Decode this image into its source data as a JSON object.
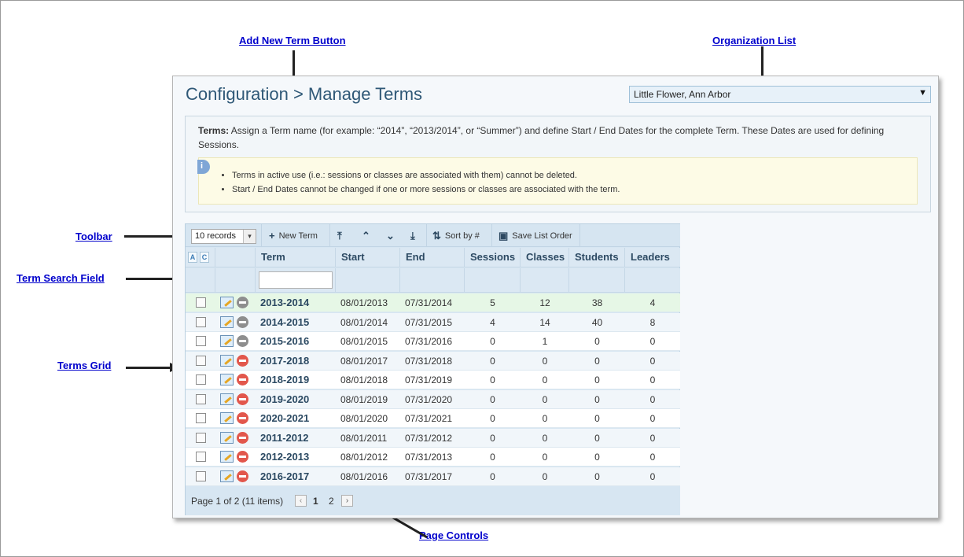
{
  "annotations": {
    "add_new_term": "Add New Term Button",
    "organization_list": "Organization List",
    "toolbar": "Toolbar",
    "term_search_field": "Term Search Field",
    "terms_grid": "Terms Grid",
    "page_controls": "Page Controls"
  },
  "header": {
    "title": "Configuration > Manage Terms",
    "organization": "Little Flower, Ann Arbor"
  },
  "info": {
    "label": "Terms:",
    "text": " Assign a Term name (for example: “2014”, “2013/2014”, or “Summer”) and define Start / End Dates for the complete Term. These Dates are used for defining Sessions.",
    "icon": "i",
    "notes": [
      "Terms in active use (i.e.: sessions or classes are associated with them) cannot be deleted.",
      "Start / End Dates cannot be changed if one or more sessions or classes are associated with the term."
    ]
  },
  "toolbar": {
    "records": "10 records",
    "new_term": "New Term",
    "sort_by": "Sort by #",
    "save_order": "Save List Order"
  },
  "grid": {
    "select_all": "A",
    "clear_all": "C",
    "columns": [
      "Term",
      "Start",
      "End",
      "Sessions",
      "Classes",
      "Students",
      "Leaders"
    ],
    "rows": [
      {
        "term": "2013-2014",
        "start": "08/01/2013",
        "end": "07/31/2014",
        "sessions": "5",
        "classes": "12",
        "students": "38",
        "leaders": "4",
        "deletable": false
      },
      {
        "term": "2014-2015",
        "start": "08/01/2014",
        "end": "07/31/2015",
        "sessions": "4",
        "classes": "14",
        "students": "40",
        "leaders": "8",
        "deletable": false
      },
      {
        "term": "2015-2016",
        "start": "08/01/2015",
        "end": "07/31/2016",
        "sessions": "0",
        "classes": "1",
        "students": "0",
        "leaders": "0",
        "deletable": false
      },
      {
        "term": "2017-2018",
        "start": "08/01/2017",
        "end": "07/31/2018",
        "sessions": "0",
        "classes": "0",
        "students": "0",
        "leaders": "0",
        "deletable": true
      },
      {
        "term": "2018-2019",
        "start": "08/01/2018",
        "end": "07/31/2019",
        "sessions": "0",
        "classes": "0",
        "students": "0",
        "leaders": "0",
        "deletable": true
      },
      {
        "term": "2019-2020",
        "start": "08/01/2019",
        "end": "07/31/2020",
        "sessions": "0",
        "classes": "0",
        "students": "0",
        "leaders": "0",
        "deletable": true
      },
      {
        "term": "2020-2021",
        "start": "08/01/2020",
        "end": "07/31/2021",
        "sessions": "0",
        "classes": "0",
        "students": "0",
        "leaders": "0",
        "deletable": true
      },
      {
        "term": "2011-2012",
        "start": "08/01/2011",
        "end": "07/31/2012",
        "sessions": "0",
        "classes": "0",
        "students": "0",
        "leaders": "0",
        "deletable": true
      },
      {
        "term": "2012-2013",
        "start": "08/01/2012",
        "end": "07/31/2013",
        "sessions": "0",
        "classes": "0",
        "students": "0",
        "leaders": "0",
        "deletable": true
      },
      {
        "term": "2016-2017",
        "start": "08/01/2016",
        "end": "07/31/2017",
        "sessions": "0",
        "classes": "0",
        "students": "0",
        "leaders": "0",
        "deletable": true
      }
    ]
  },
  "pager": {
    "info": "Page 1 of 2 (11 items)",
    "pages": [
      "1",
      "2"
    ],
    "current_page": "1"
  },
  "colors": {
    "title": "#2f5877",
    "selected_row": "#e6f7e6",
    "delete_active": "#e2574c",
    "delete_disabled": "#8e8e8e",
    "annotation_link": "#0000cc"
  }
}
